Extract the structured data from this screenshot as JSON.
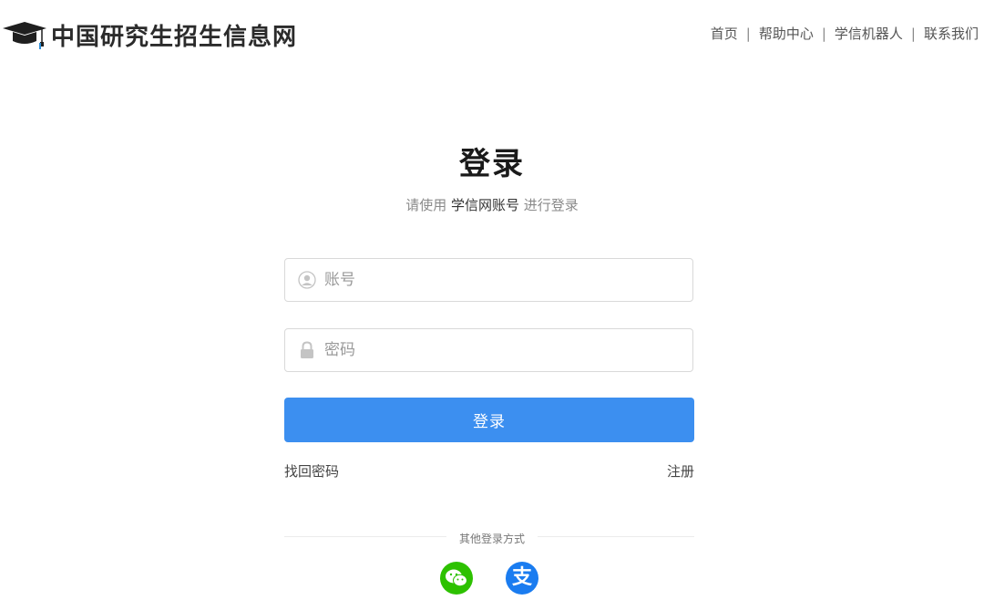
{
  "header": {
    "site_name": "中国研究生招生信息网",
    "nav": [
      "首页",
      "帮助中心",
      "学信机器人",
      "联系我们"
    ],
    "separator": "|"
  },
  "login": {
    "title": "登录",
    "subtitle_prefix": "请使用",
    "subtitle_account": "学信网账号",
    "subtitle_suffix": "进行登录",
    "username_placeholder": "账号",
    "username_value": "",
    "password_placeholder": "密码",
    "password_value": "",
    "submit_label": "登录",
    "forgot_label": "找回密码",
    "register_label": "注册",
    "other_methods_label": "其他登录方式"
  },
  "social": [
    {
      "name": "wechat",
      "icon": "wechat-icon",
      "color": "#2dc100"
    },
    {
      "name": "alipay",
      "icon": "alipay-icon",
      "glyph": "支",
      "color": "#1a7cf0"
    }
  ],
  "colors": {
    "primary": "#3c8ff0",
    "text": "#333333",
    "muted": "#8a8a8a"
  }
}
